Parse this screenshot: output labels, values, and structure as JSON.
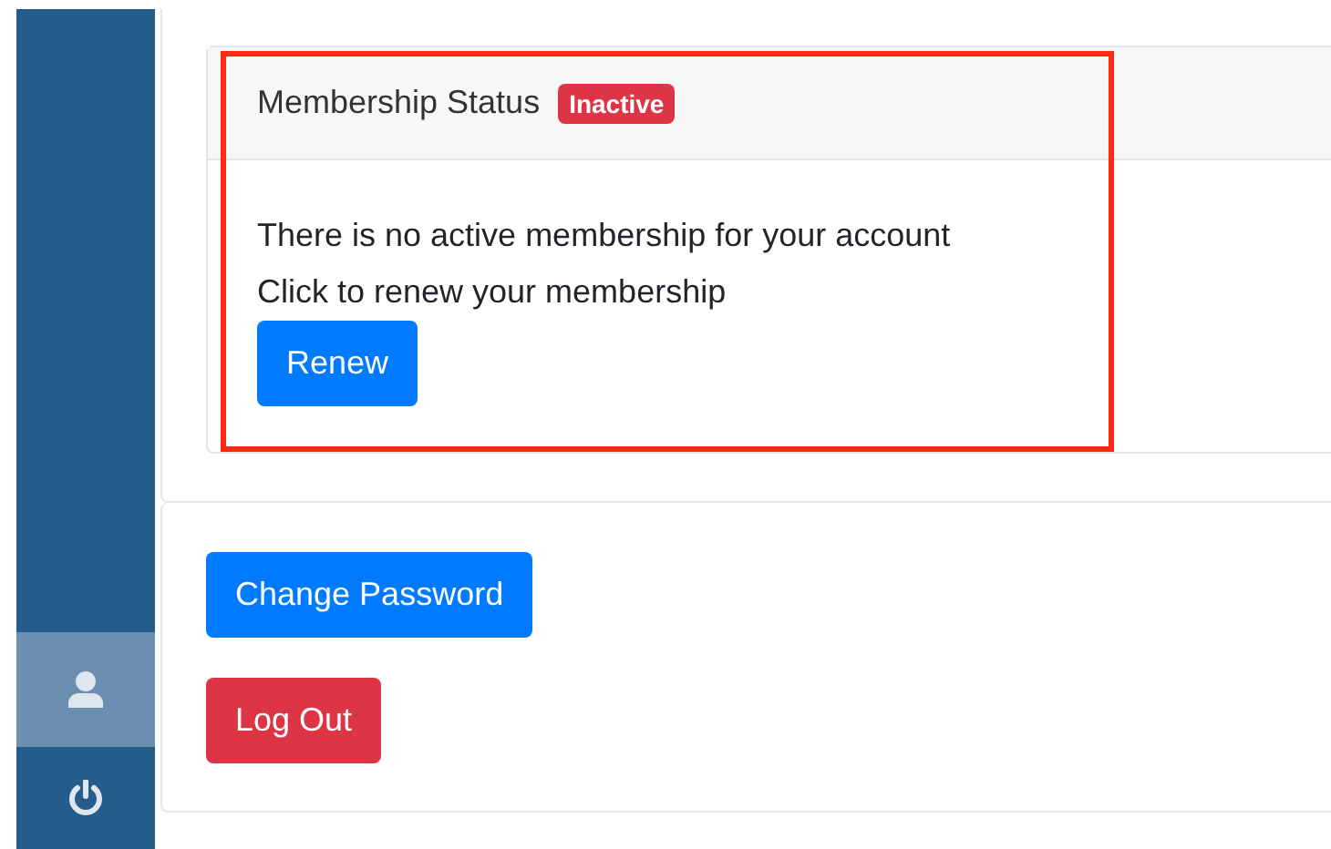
{
  "sidebar": {
    "items": [
      {
        "kind": "user",
        "selected": true
      },
      {
        "kind": "power",
        "selected": false
      }
    ]
  },
  "membership": {
    "title": "Membership Status",
    "badge": "Inactive",
    "highlighted": true,
    "message": "There is no active membership for your account",
    "prompt": "Click to renew your membership",
    "button": "Renew"
  },
  "actions": [
    {
      "label": "Change Password",
      "kind": "primary"
    },
    {
      "label": "Log Out",
      "kind": "danger"
    }
  ]
}
